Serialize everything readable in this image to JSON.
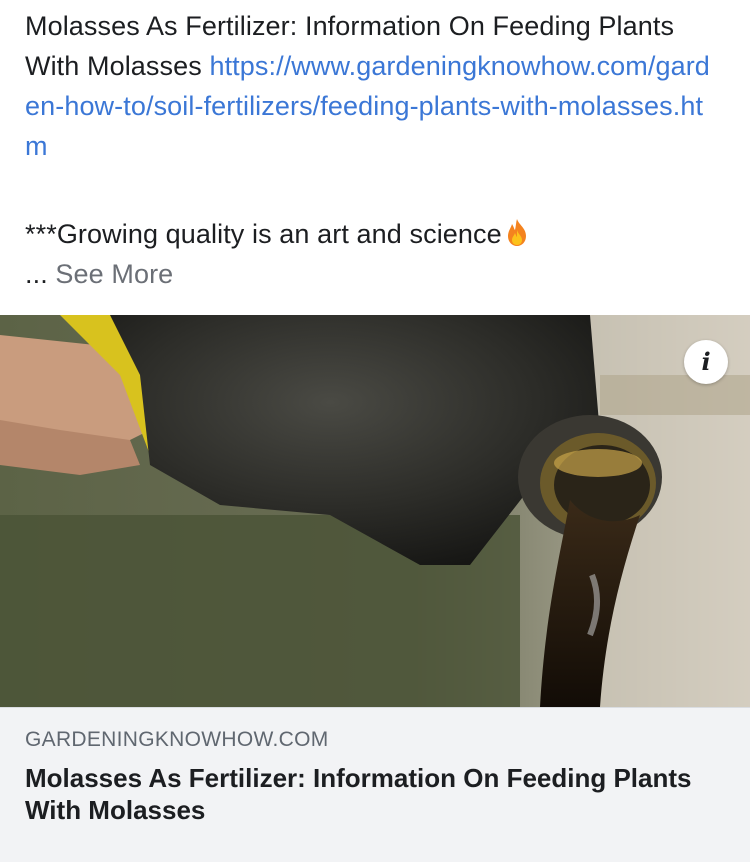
{
  "post": {
    "text_intro": "Molasses As Fertilizer: Information On Feeding Plants With Molasses",
    "link_text": "https://www.gardeningknowhow.com/garden-how-to/soil-fertilizers/feeding-plants-with-molasses.htm",
    "body_line": "***Growing quality is an art and science",
    "emoji": "fire-emoji",
    "ellipsis": "...",
    "see_more_label": "See More"
  },
  "card": {
    "image_description_icon": "molasses-pour-photo",
    "info_label": "i",
    "domain": "GARDENINGKNOWHOW.COM",
    "title": "Molasses As Fertilizer: Information On Feeding Plants With Molasses"
  },
  "colors": {
    "link": "#3b77d6",
    "see_more": "#6b6f76",
    "footer_bg": "#f2f3f5",
    "domain_text": "#606770"
  }
}
